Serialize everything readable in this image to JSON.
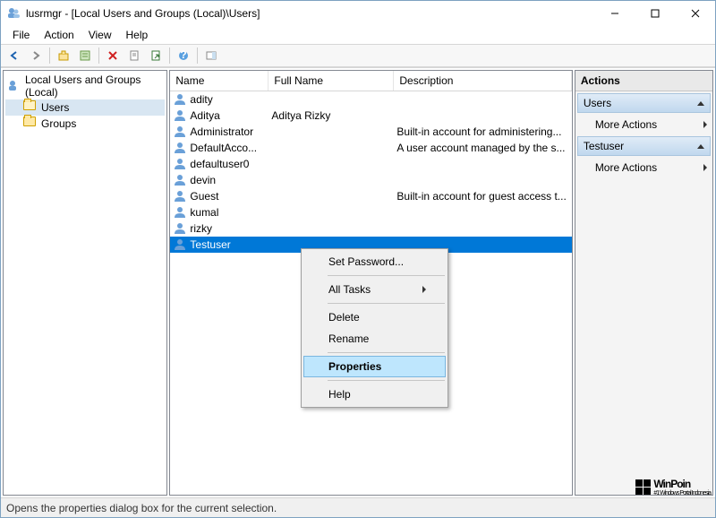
{
  "window": {
    "title": "lusrmgr - [Local Users and Groups (Local)\\Users]"
  },
  "menu": {
    "file": "File",
    "action": "Action",
    "view": "View",
    "help": "Help"
  },
  "tree": {
    "root": "Local Users and Groups (Local)",
    "users": "Users",
    "groups": "Groups"
  },
  "columns": {
    "name": "Name",
    "full": "Full Name",
    "desc": "Description"
  },
  "users": [
    {
      "name": "adity",
      "full": "",
      "desc": ""
    },
    {
      "name": "Aditya",
      "full": "Aditya Rizky",
      "desc": ""
    },
    {
      "name": "Administrator",
      "full": "",
      "desc": "Built-in account for administering..."
    },
    {
      "name": "DefaultAcco...",
      "full": "",
      "desc": "A user account managed by the s..."
    },
    {
      "name": "defaultuser0",
      "full": "",
      "desc": ""
    },
    {
      "name": "devin",
      "full": "",
      "desc": ""
    },
    {
      "name": "Guest",
      "full": "",
      "desc": "Built-in account for guest access t..."
    },
    {
      "name": "kumal",
      "full": "",
      "desc": ""
    },
    {
      "name": "rizky",
      "full": "",
      "desc": ""
    },
    {
      "name": "Testuser",
      "full": "",
      "desc": ""
    }
  ],
  "actions": {
    "header": "Actions",
    "sec1": "Users",
    "more1": "More Actions",
    "sec2": "Testuser",
    "more2": "More Actions"
  },
  "context": {
    "setpw": "Set Password...",
    "alltasks": "All Tasks",
    "delete": "Delete",
    "rename": "Rename",
    "properties": "Properties",
    "help": "Help"
  },
  "status": "Opens the properties dialog box for the current selection.",
  "watermark": {
    "brand": "WinPoin",
    "tag": "#1 Windows Portal Indonesia"
  }
}
